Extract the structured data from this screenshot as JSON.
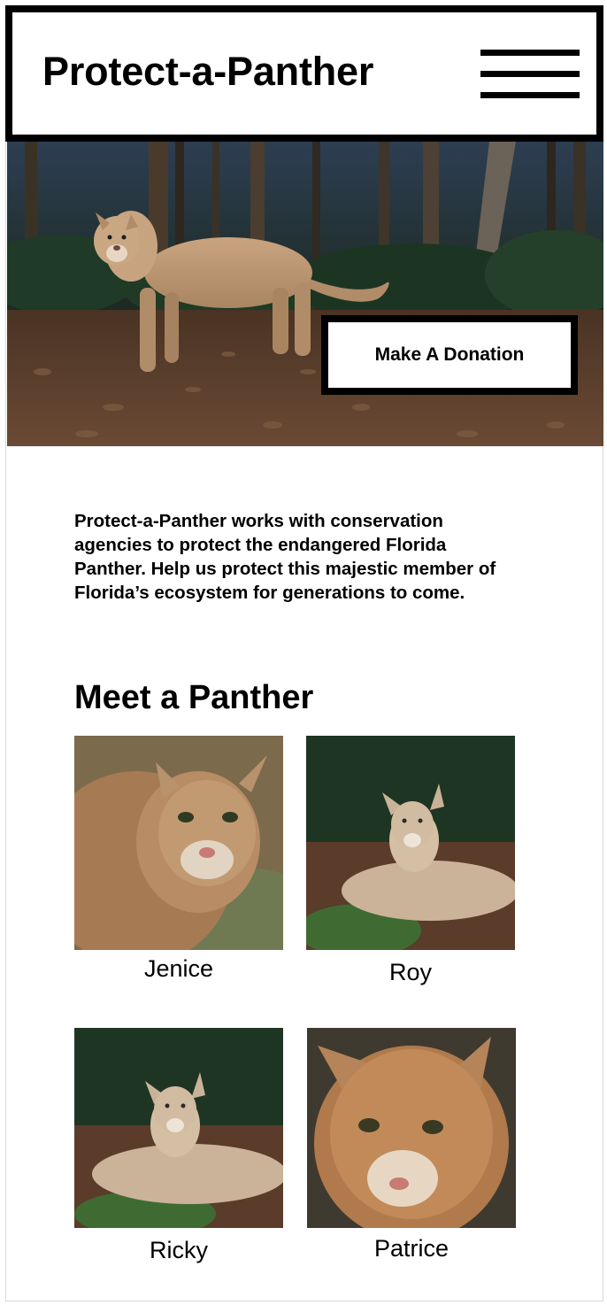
{
  "header": {
    "brand": "Protect-a-Panther",
    "menu_icon": "hamburger-menu-icon"
  },
  "hero": {
    "image": "florida-panther-in-forest",
    "donate_label": "Make A Donation"
  },
  "intro": {
    "text": "Protect-a-Panther works with conservation agencies to protect the endangered Florida Panther. Help us protect this majestic member of Florida’s ecosystem for generations to come."
  },
  "section": {
    "title": "Meet a Panther"
  },
  "panthers": [
    {
      "name": "Jenice",
      "image": "panther-portrait-closeup"
    },
    {
      "name": "Roy",
      "image": "panther-lying-in-forest"
    },
    {
      "name": "Ricky",
      "image": "panther-lying-in-forest"
    },
    {
      "name": "Patrice",
      "image": "panther-face-closeup"
    }
  ],
  "colors": {
    "border": "#000000",
    "background": "#ffffff",
    "text": "#000000"
  }
}
